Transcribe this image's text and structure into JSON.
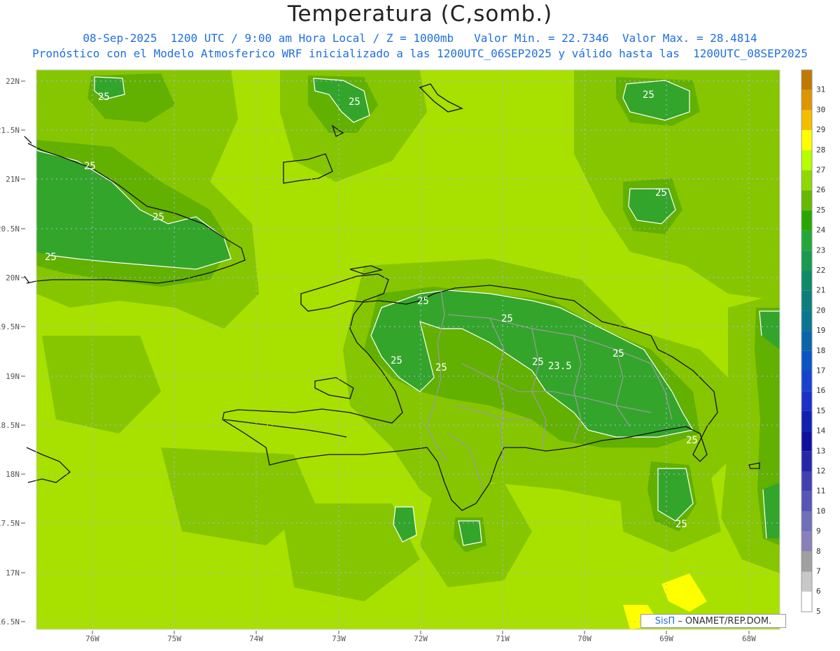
{
  "header": {
    "title": "Temperatura (C,somb.)",
    "subtitle_line1": "08-Sep-2025  1200 UTC / 9:00 am Hora Local / Z = 1000mb   Valor Min. = 22.7346  Valor Max. = 28.4814",
    "subtitle_line2": "Pronóstico con el Modelo Atmosferico WRF inicializado a las 1200UTC_06SEP2025 y válido hasta las  1200UTC_08SEP2025"
  },
  "map": {
    "lat_ticks": [
      "22N",
      "21.5N",
      "21N",
      "20.5N",
      "20N",
      "19.5N",
      "19N",
      "18.5N",
      "18N",
      "17.5N",
      "17N",
      "16.5N"
    ],
    "lon_ticks": [
      "76W",
      "75W",
      "74W",
      "73W",
      "72W",
      "71W",
      "70W",
      "69W",
      "68W"
    ],
    "contour_labels": [
      "25",
      "25",
      "25",
      "25",
      "25",
      "25",
      "25",
      "25",
      "25",
      "25",
      "25",
      "25",
      "25",
      "23.5",
      "25",
      "25",
      "25"
    ]
  },
  "legend": {
    "levels": [
      "31",
      "30",
      "29",
      "28",
      "27",
      "26",
      "25",
      "24",
      "23",
      "22",
      "21",
      "20",
      "19",
      "18",
      "17",
      "16",
      "15",
      "14",
      "13",
      "12",
      "11",
      "10",
      "9",
      "8",
      "7",
      "6",
      "5"
    ],
    "colors": [
      "#c07800",
      "#dd9500",
      "#f5bd00",
      "#ffff00",
      "#b7ff00",
      "#90d800",
      "#66b800",
      "#2aa600",
      "#22a83a",
      "#199a4e",
      "#0f8a68",
      "#0a7e7a",
      "#0a7590",
      "#0a64a8",
      "#0a55c0",
      "#1742d0",
      "#1a30c8",
      "#1020b0",
      "#1010a0",
      "#2525a8",
      "#4040b0",
      "#5555b5",
      "#7070b8",
      "#8880b8",
      "#a0a0a0",
      "#c8c8c8",
      "#ffffff"
    ]
  },
  "credit": {
    "brand": "SisΠ",
    "text": "– ONAMET/REP.DOM."
  },
  "colors": {
    "base": "#a8e000",
    "mid": "#84c400",
    "dark": "#5fae0a",
    "deep": "#31a030"
  }
}
